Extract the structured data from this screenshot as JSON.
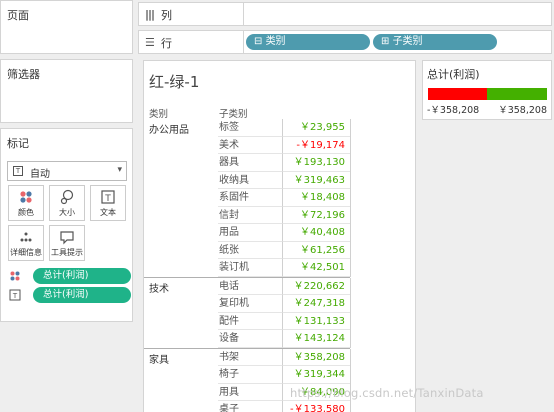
{
  "panels": {
    "pages": "页面",
    "filters": "筛选器",
    "marks": "标记"
  },
  "marks": {
    "type_label": "自动",
    "buttons": [
      "颜色",
      "大小",
      "文本",
      "详细信息",
      "工具提示"
    ],
    "pills": [
      "总计(利润)",
      "总计(利润)"
    ]
  },
  "shelves": {
    "columns_label": "列",
    "rows_label": "行",
    "row_pills": [
      "类别",
      "子类别"
    ]
  },
  "view": {
    "title": "红-绿-1",
    "header_category": "类别",
    "header_subcategory": "子类别",
    "groups": [
      {
        "category": "办公用品",
        "rows": [
          {
            "sub": "标签",
            "value": "￥23,955",
            "color": "#44aa00"
          },
          {
            "sub": "美术",
            "value": "-￥19,174",
            "color": "#ff0000"
          },
          {
            "sub": "器具",
            "value": "￥193,130",
            "color": "#44aa00"
          },
          {
            "sub": "收纳具",
            "value": "￥319,463",
            "color": "#44aa00"
          },
          {
            "sub": "系固件",
            "value": "￥18,408",
            "color": "#44aa00"
          },
          {
            "sub": "信封",
            "value": "￥72,196",
            "color": "#44aa00"
          },
          {
            "sub": "用品",
            "value": "￥40,408",
            "color": "#44aa00"
          },
          {
            "sub": "纸张",
            "value": "￥61,256",
            "color": "#44aa00"
          },
          {
            "sub": "装订机",
            "value": "￥42,501",
            "color": "#44aa00"
          }
        ]
      },
      {
        "category": "技术",
        "rows": [
          {
            "sub": "电话",
            "value": "￥220,662",
            "color": "#44aa00"
          },
          {
            "sub": "复印机",
            "value": "￥247,318",
            "color": "#44aa00"
          },
          {
            "sub": "配件",
            "value": "￥131,133",
            "color": "#44aa00"
          },
          {
            "sub": "设备",
            "value": "￥143,124",
            "color": "#44aa00"
          }
        ]
      },
      {
        "category": "家具",
        "rows": [
          {
            "sub": "书架",
            "value": "￥358,208",
            "color": "#44aa00"
          },
          {
            "sub": "椅子",
            "value": "￥319,344",
            "color": "#44aa00"
          },
          {
            "sub": "用具",
            "value": "￥84,090",
            "color": "#44aa00"
          },
          {
            "sub": "桌子",
            "value": "-￥133,580",
            "color": "#ff0000"
          }
        ]
      }
    ]
  },
  "legend": {
    "title": "总计(利润)",
    "min": "-￥358,208",
    "max": "￥358,208",
    "negative_color": "#ff0000",
    "positive_color": "#44b000"
  },
  "watermark": "https://blog.csdn.net/TanxinData"
}
